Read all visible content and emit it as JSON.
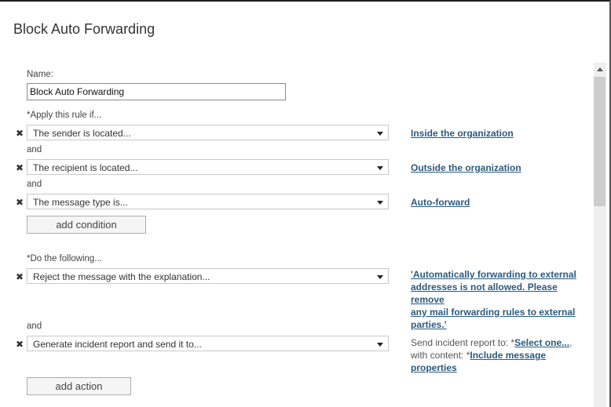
{
  "dialog": {
    "title": "Block Auto Forwarding"
  },
  "name_field": {
    "label": "Name:",
    "value": "Block Auto Forwarding"
  },
  "conditions": {
    "label": "*Apply this rule if...",
    "connector": "and",
    "items": [
      {
        "select": "The sender is located...",
        "value": "Inside the organization"
      },
      {
        "select": "The recipient is located...",
        "value": "Outside the organization"
      },
      {
        "select": "The message type is...",
        "value": "Auto-forward"
      }
    ],
    "add_button": "add condition"
  },
  "actions": {
    "label": "*Do the following...",
    "connector": "and",
    "items": [
      {
        "select": "Reject the message with the explanation...",
        "value_lines": [
          "'Automatically forwarding to external",
          "addresses is not allowed. Please remove",
          "any mail forwarding rules to external",
          "parties.'"
        ]
      },
      {
        "select": "Generate incident report and send it to...",
        "send_to_prefix": "Send incident report to: *",
        "send_to_link": "Select one...",
        "send_to_suffix": ",",
        "content_prefix": "with content: *",
        "content_link": "Include message properties"
      }
    ],
    "add_button": "add action"
  },
  "icons": {
    "remove": "close-x-icon",
    "dropdown": "chevron-down-icon",
    "scroll_up": "chevron-up-icon"
  },
  "colors": {
    "link": "#2b5a7e",
    "text": "#333333",
    "scroll_thumb": "#cdcdcd"
  }
}
